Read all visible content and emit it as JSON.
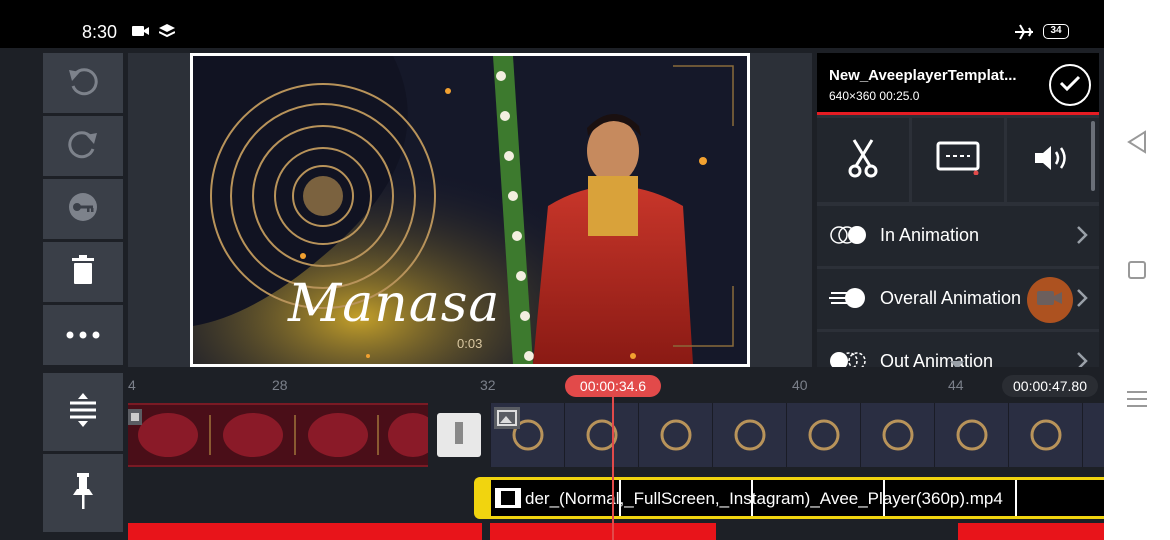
{
  "status_bar": {
    "time": "8:30",
    "battery": "34",
    "icons": [
      "video-camera-icon",
      "layers-icon",
      "airplane-icon"
    ]
  },
  "left_toolbar": [
    "undo-icon",
    "redo-icon",
    "keyframe-key-icon",
    "delete-icon",
    "more-icon"
  ],
  "preview": {
    "title": "Manasa",
    "time": "0:03"
  },
  "clip": {
    "name": "New_AveeplayerTemplat...",
    "resolution": "640×360",
    "duration": "00:25.0"
  },
  "tools": [
    "scissors-icon",
    "subtitle-icon",
    "volume-icon"
  ],
  "animations": [
    {
      "label": "In Animation"
    },
    {
      "label": "Overall Animation"
    },
    {
      "label": "Out Animation"
    }
  ],
  "timeline": {
    "ruler": [
      "4",
      "28",
      "32",
      "40",
      "44"
    ],
    "playhead_time": "00:00:34.6",
    "end_time": "00:00:47.80",
    "layer_name": "der_(Normal,_FullScreen,_Instagram)_Avee_Player(360p).mp4"
  },
  "bottom_toolbar": [
    "expand-tracks-icon",
    "pin-icon"
  ],
  "nav": [
    "back-icon",
    "home-icon",
    "recents-icon"
  ],
  "colors": {
    "accent_red": "#e51c23",
    "layer_yellow": "#f1d40f",
    "playhead": "#e24a4a"
  }
}
